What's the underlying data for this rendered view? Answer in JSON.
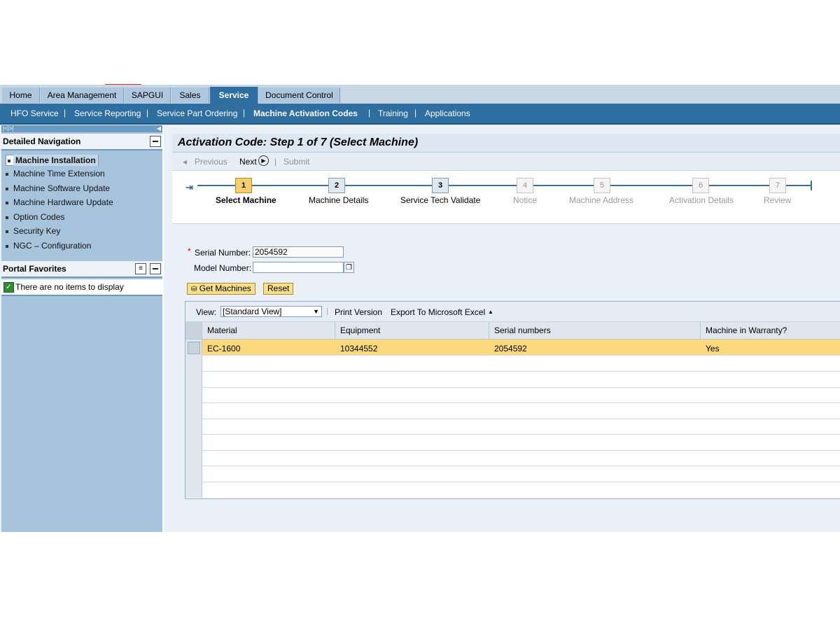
{
  "top_tabs": [
    "Home",
    "Area Management",
    "SAPGUI",
    "Sales",
    "Service",
    "Document Control"
  ],
  "active_tab": "Service",
  "sub_nav": [
    "HFO Service",
    "Service Reporting",
    "Service Part Ordering",
    "Machine Activation Codes",
    "Training",
    "Applications"
  ],
  "active_sub_nav": "Machine Activation Codes",
  "left_nav": {
    "collapse_glyphs": "|<|>|",
    "detailed_navigation_title": "Detailed Navigation",
    "items": [
      "Machine Installation",
      "Machine Time Extension",
      "Machine Software Update",
      "Machine Hardware Update",
      "Option Codes",
      "Security Key",
      "NGC – Configuration"
    ],
    "selected_item": "Machine Installation",
    "portal_favorites_title": "Portal Favorites",
    "favorites_empty": "There are no items to display"
  },
  "main": {
    "title": "Activation Code: Step 1  of 7  (Select Machine)",
    "toolbar": {
      "previous": "Previous",
      "next": "Next",
      "submit": "Submit"
    },
    "steps": [
      {
        "num": "1",
        "label": "Select Machine",
        "state": "current"
      },
      {
        "num": "2",
        "label": "Machine Details",
        "state": "enabled"
      },
      {
        "num": "3",
        "label": "Service Tech Validate",
        "state": "enabled"
      },
      {
        "num": "4",
        "label": "Notice",
        "state": "disabled"
      },
      {
        "num": "5",
        "label": "Machine Address",
        "state": "disabled"
      },
      {
        "num": "6",
        "label": "Activation Details",
        "state": "disabled"
      },
      {
        "num": "7",
        "label": "Review",
        "state": "disabled"
      }
    ],
    "form": {
      "required_mark": "*",
      "serial_label": "Serial Number:",
      "serial_value": "2054592",
      "model_label": "Model Number:",
      "model_value": "",
      "get_machines": "Get Machines",
      "reset": "Reset"
    },
    "table": {
      "view_label": "View:",
      "view_value": "[Standard View]",
      "print_version": "Print Version",
      "export": "Export To Microsoft Excel",
      "columns": [
        "Material",
        "Equipment",
        "Serial numbers",
        "Machine in Warranty?"
      ],
      "rows": [
        {
          "material": "EC-1600",
          "equipment": "10344552",
          "serial": "2054592",
          "warranty": "Yes"
        }
      ]
    }
  },
  "colors": {
    "tab_active": "#2f6ea1",
    "subnav_bg": "#2f6ea1",
    "row_highlight": "#fcd97c",
    "step_current": "#f5d06a"
  }
}
